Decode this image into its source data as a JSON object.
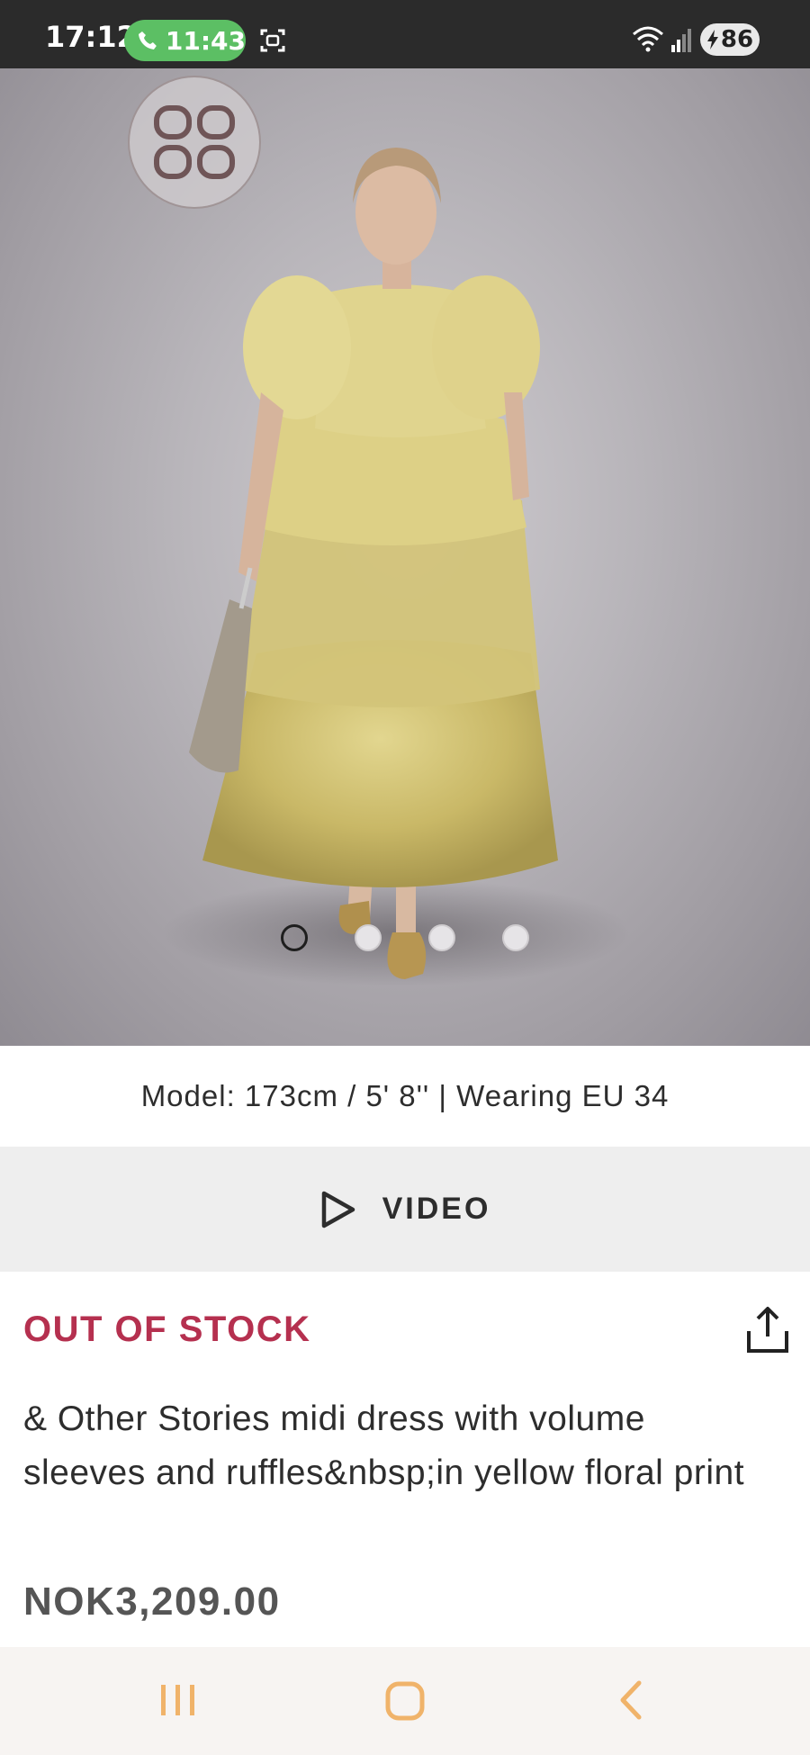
{
  "status_bar": {
    "time": "17:12",
    "call_duration": "11:43",
    "battery": "86",
    "call_color": "#5cbf64"
  },
  "hero": {
    "grid_icon": "grid-view-icon",
    "carousel": {
      "total": 4,
      "active_index": 0
    }
  },
  "model_info": "Model: 173cm / 5' 8'' | Wearing EU 34",
  "video": {
    "label": "VIDEO",
    "icon": "play-icon"
  },
  "product": {
    "stock_status": "OUT OF STOCK",
    "stock_color": "#b5304f",
    "title": "& Other Stories midi dress with volume sleeves and ruffles&nbsp;in yellow floral print",
    "price": "NOK3,209.00",
    "share_icon": "share-icon"
  },
  "nav": {
    "recent_icon": "recent-apps-icon",
    "home_icon": "home-icon",
    "back_icon": "back-icon",
    "icon_color": "#f0b36a"
  }
}
